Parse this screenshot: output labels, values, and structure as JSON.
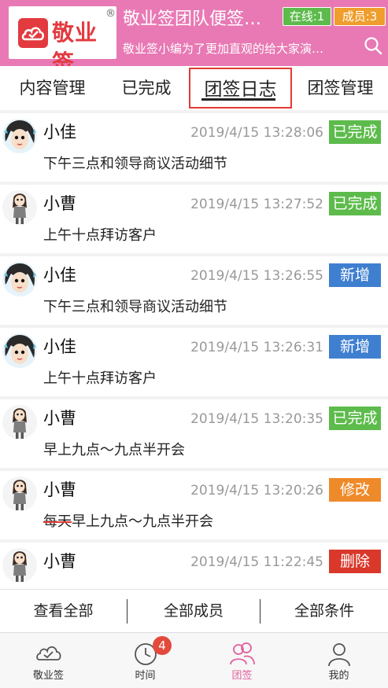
{
  "header": {
    "logo_text": "敬业签",
    "logo_reg": "®",
    "team_name": "敬业签团队便签…",
    "team_desc": "敬业签小编为了更加直观的给大家演…",
    "online": "在线:1",
    "members": "成员:3",
    "search_icon": "search-icon"
  },
  "tabs": [
    {
      "label": "内容管理"
    },
    {
      "label": "已完成"
    },
    {
      "label": "团签日志"
    },
    {
      "label": "团签管理"
    }
  ],
  "active_tab": "团签日志",
  "log_entries": [
    {
      "avatar": "avatar-xiaojia",
      "name": "小佳",
      "time": "2019/4/15 13:28:06",
      "status": "已完成",
      "content": "下午三点和领导商议活动细节"
    },
    {
      "avatar": "avatar-xiaocao",
      "name": "小曹",
      "time": "2019/4/15 13:27:52",
      "status": "已完成",
      "content": "上午十点拜访客户"
    },
    {
      "avatar": "avatar-xiaojia",
      "name": "小佳",
      "time": "2019/4/15 13:26:55",
      "status": "新增",
      "content": "下午三点和领导商议活动细节"
    },
    {
      "avatar": "avatar-xiaojia",
      "name": "小佳",
      "time": "2019/4/15 13:26:31",
      "status": "新增",
      "content": "上午十点拜访客户"
    },
    {
      "avatar": "avatar-xiaocao",
      "name": "小曹",
      "time": "2019/4/15 13:20:35",
      "status": "已完成",
      "content": "早上九点～九点半开会"
    },
    {
      "avatar": "avatar-xiaocao",
      "name": "小曹",
      "time": "2019/4/15 13:20:26",
      "status": "修改",
      "content_struck": "每天",
      "content": "早上九点～九点半开会"
    },
    {
      "avatar": "avatar-xiaocao",
      "name": "小曹",
      "time": "2019/4/15 11:22:45",
      "status": "删除",
      "content": ""
    }
  ],
  "status_colors": {
    "已完成": "#5dbb4c",
    "新增": "#3f7fd0",
    "修改": "#ef8a2a",
    "删除": "#d9382b"
  },
  "actions": [
    {
      "label": "查看全部"
    },
    {
      "label": "全部成员"
    },
    {
      "label": "全部条件"
    }
  ],
  "bottom_nav": [
    {
      "label": "敬业签",
      "icon": "cloud-icon"
    },
    {
      "label": "时间",
      "icon": "clock-icon",
      "badge": "4"
    },
    {
      "label": "团签",
      "icon": "team-icon"
    },
    {
      "label": "我的",
      "icon": "user-icon"
    }
  ],
  "colors": {
    "header_bg": "#e879b4",
    "accent_pink": "#e0609f",
    "tab_highlight": "#e53935"
  }
}
